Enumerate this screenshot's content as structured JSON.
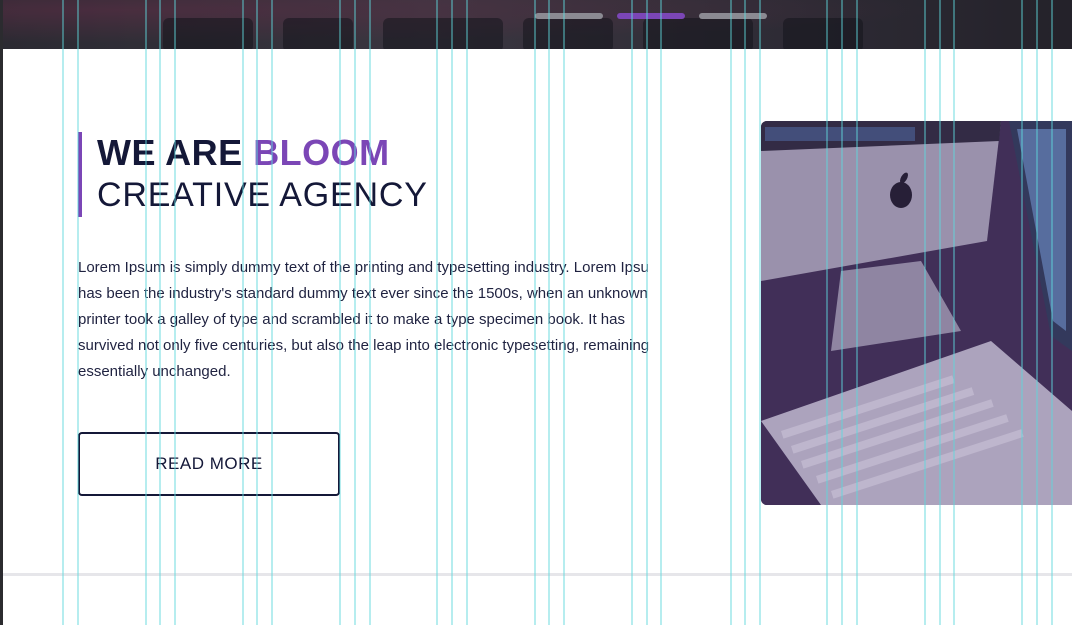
{
  "hero": {
    "slides": [
      {
        "active": false
      },
      {
        "active": true
      },
      {
        "active": false
      }
    ],
    "dot_color": "#8b8a92",
    "active_dot_color": "#7b46b6"
  },
  "headline": {
    "prefix": "WE ARE",
    "brand": "BLOOM",
    "subtitle": "CREATIVE AGENCY"
  },
  "intro": {
    "lines": [
      "Lorem Ipsum is simply dummy text of the printing and typesetting industry. Lorem Ipsu",
      "has been the industry's standard dummy text ever since the 1500s, when an unknown",
      "printer took a galley of type and scrambled it to make a type specimen book. It has",
      "survived not only five centuries, but also the leap into electronic typesetting, remaining",
      "essentially unchanged."
    ]
  },
  "cta": {
    "label": "READ MORE"
  },
  "image": {
    "subject": "imac-and-keyboard-photo"
  },
  "colors": {
    "accent": "#7b46b6",
    "text": "#141838",
    "guide": "#5fd8dc"
  }
}
